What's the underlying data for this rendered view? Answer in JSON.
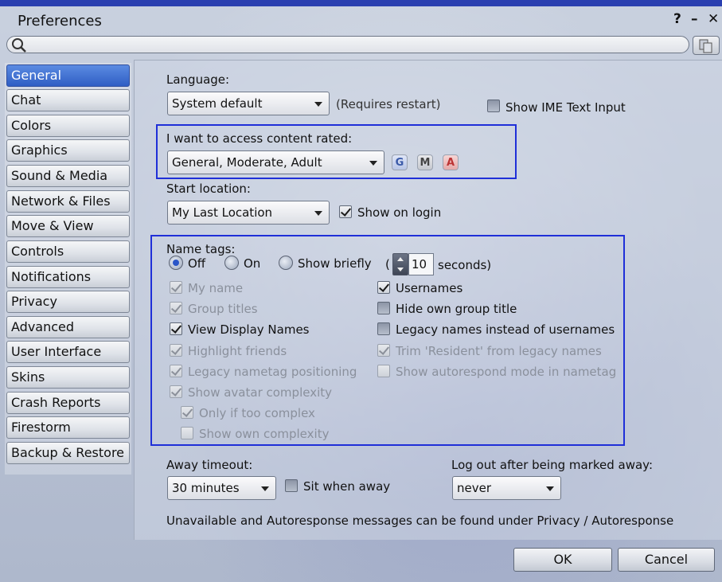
{
  "window": {
    "title": "Preferences",
    "help_label": "?",
    "minimize_label": "–",
    "close_label": "✕"
  },
  "search": {
    "placeholder": "",
    "icon": "search-icon",
    "clear_icon": "copy-icon"
  },
  "sidebar": {
    "items": [
      {
        "label": "General",
        "active": true
      },
      {
        "label": "Chat"
      },
      {
        "label": "Colors"
      },
      {
        "label": "Graphics"
      },
      {
        "label": "Sound & Media"
      },
      {
        "label": "Network & Files"
      },
      {
        "label": "Move & View"
      },
      {
        "label": "Controls"
      },
      {
        "label": "Notifications"
      },
      {
        "label": "Privacy"
      },
      {
        "label": "Advanced"
      },
      {
        "label": "User Interface"
      },
      {
        "label": "Skins"
      },
      {
        "label": "Crash Reports"
      },
      {
        "label": "Firestorm"
      },
      {
        "label": "Backup & Restore"
      }
    ]
  },
  "general": {
    "language_label": "Language:",
    "language_value": "System default",
    "requires_restart": "(Requires restart)",
    "ime_label": "Show IME Text Input",
    "ime_checked": false,
    "content_rated_label": "I want to access content rated:",
    "content_rated_value": "General, Moderate, Adult",
    "ratings": [
      "G",
      "M",
      "A"
    ],
    "start_location_label": "Start location:",
    "start_location_value": "My Last Location",
    "show_on_login_label": "Show on login",
    "show_on_login_checked": true,
    "name_tags_label": "Name tags:",
    "name_tag_options": [
      "Off",
      "On",
      "Show briefly"
    ],
    "name_tag_selected": "Off",
    "paren_open": "(",
    "seconds_value": "10",
    "seconds_label": "seconds)",
    "left_options": [
      {
        "label": "My name",
        "checked": true,
        "dim": true
      },
      {
        "label": "Group titles",
        "checked": true,
        "dim": true
      },
      {
        "label": "View Display Names",
        "checked": true,
        "dim": false
      },
      {
        "label": "Highlight friends",
        "checked": true,
        "dim": true
      },
      {
        "label": "Legacy nametag positioning",
        "checked": true,
        "dim": true
      },
      {
        "label": "Show avatar complexity",
        "checked": true,
        "dim": true
      },
      {
        "label": "Only if too complex",
        "checked": true,
        "dim": true
      },
      {
        "label": "Show own complexity",
        "checked": false,
        "dim": true
      }
    ],
    "right_options": [
      {
        "label": "Usernames",
        "checked": true,
        "dim": false
      },
      {
        "label": "Hide own group title",
        "checked": false,
        "dim": false
      },
      {
        "label": "Legacy names instead of usernames",
        "checked": false,
        "dim": false
      },
      {
        "label": "Trim 'Resident' from legacy names",
        "checked": true,
        "dim": true
      },
      {
        "label": "Show autorespond mode in nametag",
        "checked": false,
        "dim": true
      }
    ],
    "away_timeout_label": "Away timeout:",
    "away_timeout_value": "30 minutes",
    "sit_when_away_label": "Sit when away",
    "sit_when_away_checked": false,
    "logout_label": "Log out after being marked away:",
    "logout_value": "never",
    "footer_note": "Unavailable and Autoresponse messages can be found under Privacy / Autoresponse"
  },
  "buttons": {
    "ok": "OK",
    "cancel": "Cancel"
  },
  "colors": {
    "active_tab": "#3a6ad0",
    "highlight_box": "#1f2fd8"
  }
}
